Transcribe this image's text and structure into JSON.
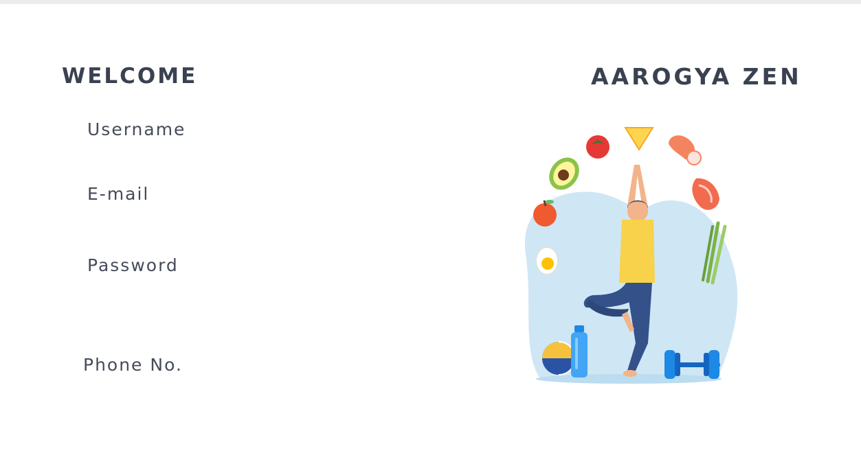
{
  "header": {
    "welcome": "WELCOME",
    "brand": "AAROGYA ZEN"
  },
  "form": {
    "username_label": "Username",
    "email_label": "E-mail",
    "password_label": "Password",
    "phone_label": "Phone No."
  },
  "colors": {
    "heading": "#3a4150",
    "label": "#454b58",
    "blob": "#cfe6f5",
    "shirt": "#f7d24a",
    "pants": "#34518a"
  },
  "illustration": {
    "icon": "yoga-fitness-illustration"
  }
}
